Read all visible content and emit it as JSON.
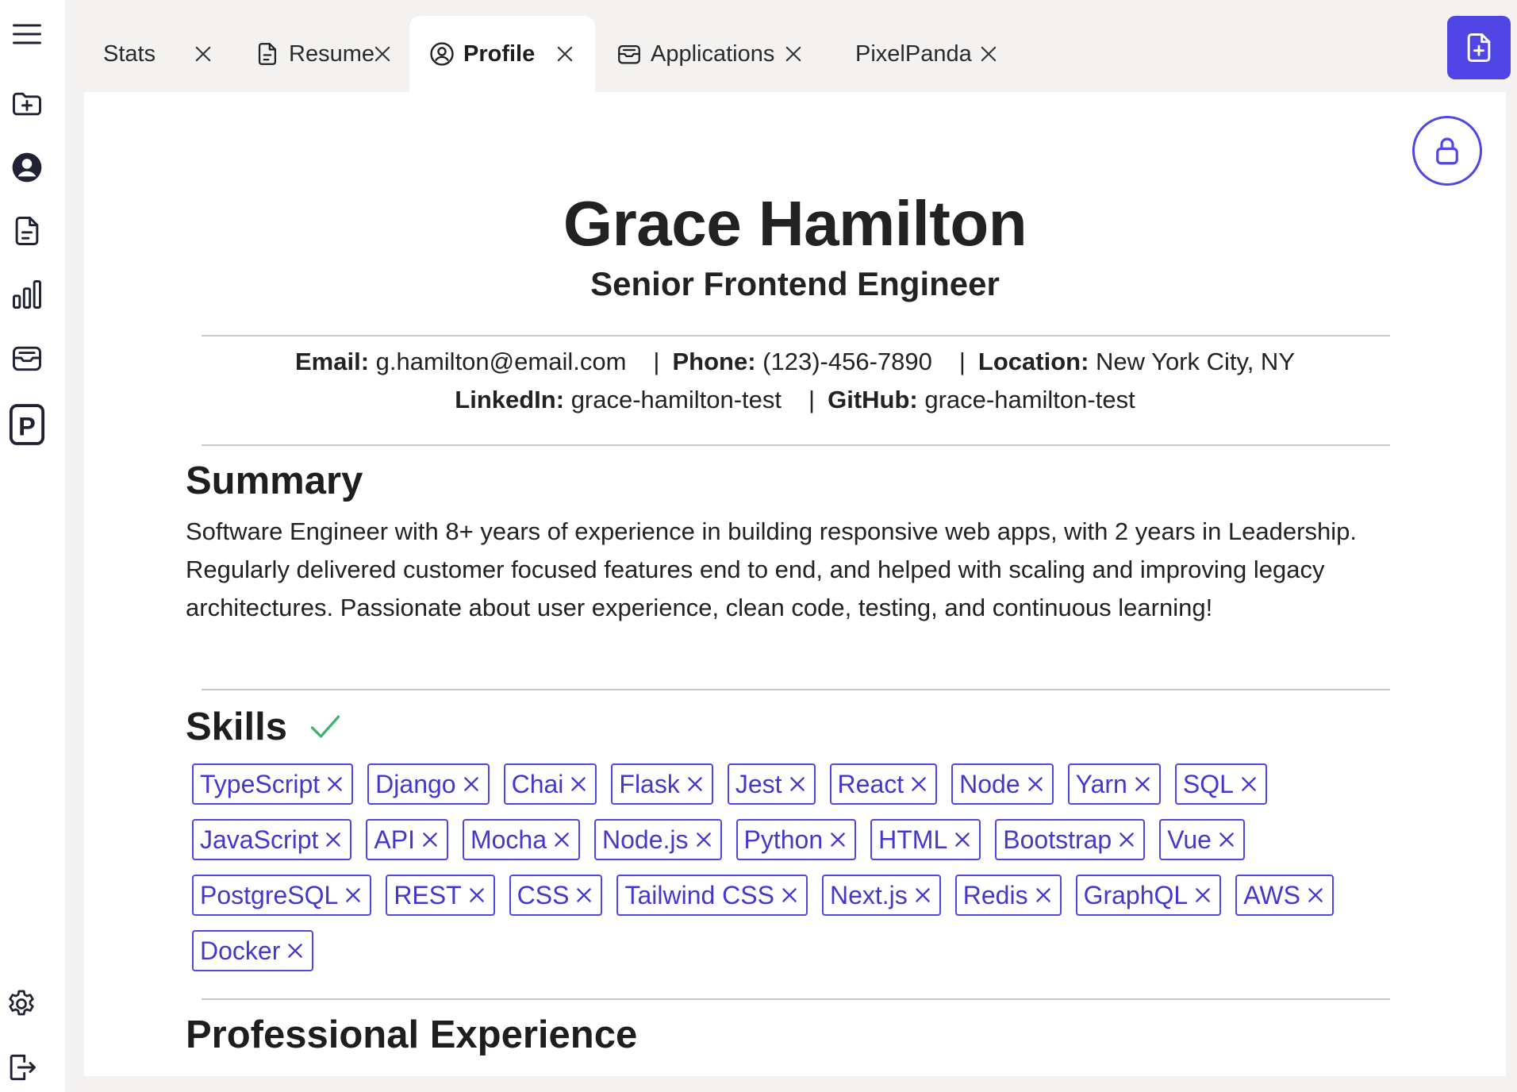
{
  "sidebar": {
    "items": [
      {
        "icon": "menu-icon"
      },
      {
        "icon": "folder-plus-icon"
      },
      {
        "icon": "user-circle-icon"
      },
      {
        "icon": "document-icon"
      },
      {
        "icon": "bar-chart-icon"
      },
      {
        "icon": "inbox-icon"
      },
      {
        "icon": "pixelpanda-logo-icon",
        "label": "P"
      },
      {
        "icon": "gear-icon"
      },
      {
        "icon": "logout-icon"
      }
    ]
  },
  "tabs": [
    {
      "label": "Stats",
      "icon": null,
      "active": false
    },
    {
      "label": "Resume",
      "icon": "document-icon",
      "active": false
    },
    {
      "label": "Profile",
      "icon": "user-circle-icon",
      "active": true
    },
    {
      "label": "Applications",
      "icon": "inbox-icon",
      "active": false
    },
    {
      "label": "PixelPanda",
      "icon": null,
      "active": false
    }
  ],
  "profile": {
    "name": "Grace Hamilton",
    "title": "Senior Frontend Engineer",
    "contact": {
      "email_label": "Email:",
      "email": "g.hamilton@email.com",
      "phone_label": "Phone:",
      "phone": "(123)-456-7890",
      "location_label": "Location:",
      "location": "New York City, NY",
      "linkedin_label": "LinkedIn:",
      "linkedin": "grace-hamilton-test",
      "github_label": "GitHub:",
      "github": "grace-hamilton-test",
      "separator": "|"
    },
    "summary_heading": "Summary",
    "summary": "Software Engineer with 8+ years of experience in building responsive web apps, with 2 years in Leadership. Regularly delivered customer focused features end to end, and helped with scaling and improving legacy architectures. Passionate about user experience, clean code, testing, and continuous learning!",
    "skills_heading": "Skills",
    "skills": [
      "TypeScript",
      "Django",
      "Chai",
      "Flask",
      "Jest",
      "React",
      "Node",
      "Yarn",
      "SQL",
      "JavaScript",
      "API",
      "Mocha",
      "Node.js",
      "Python",
      "HTML",
      "Bootstrap",
      "Vue",
      "PostgreSQL",
      "REST",
      "CSS",
      "Tailwind CSS",
      "Next.js",
      "Redis",
      "GraphQL",
      "AWS",
      "Docker"
    ],
    "experience_heading": "Professional Experience"
  },
  "colors": {
    "accent": "#4f46e5",
    "check": "#3cb371",
    "background": "#f3f2f0"
  }
}
